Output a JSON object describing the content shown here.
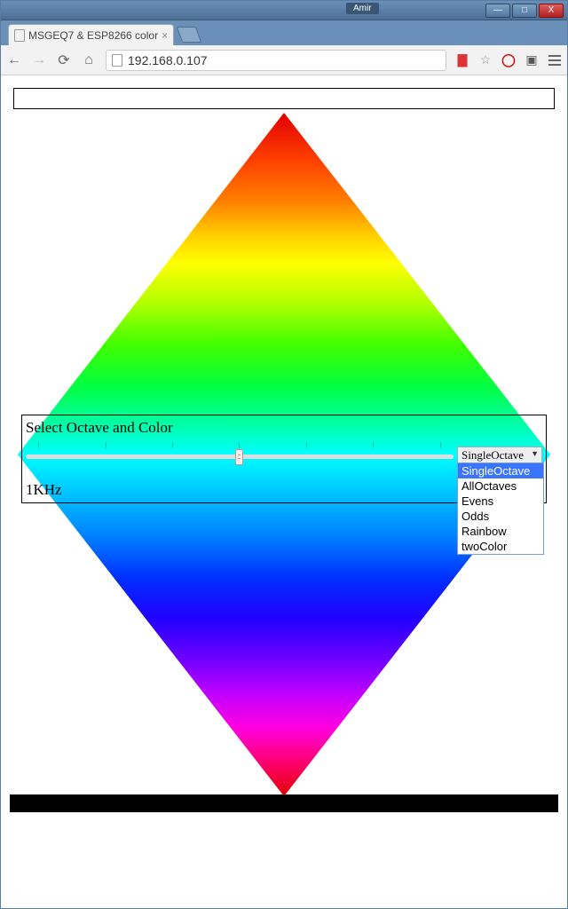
{
  "window": {
    "user_label": "Amir",
    "min_symbol": "—",
    "max_symbol": "□",
    "close_symbol": "X"
  },
  "tab": {
    "title": "MSGEQ7 & ESP8266 color",
    "close_symbol": "×"
  },
  "toolbar": {
    "back": "←",
    "forward": "→",
    "reload": "⟳",
    "home": "⌂",
    "url": "192.168.0.107",
    "star": "☆",
    "adblock": "◯",
    "cast": "▣"
  },
  "panel": {
    "title": "Select Octave and Color",
    "frequency": "1KHz",
    "select_value": "SingleOctave",
    "options": [
      "SingleOctave",
      "AllOctaves",
      "Evens",
      "Odds",
      "Rainbow",
      "twoColor"
    ],
    "selected_index": 0
  }
}
